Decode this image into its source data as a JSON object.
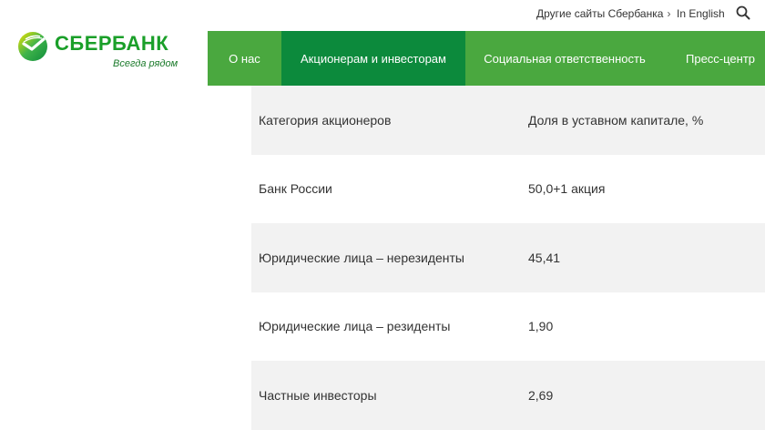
{
  "topbar": {
    "other_sites": "Другие сайты Сбербанка",
    "language": "In English"
  },
  "logo": {
    "brand": "СБЕРБАНК",
    "tagline": "Всегда рядом"
  },
  "nav": {
    "items": [
      {
        "label": "О нас"
      },
      {
        "label": "Акционерам и инвесторам"
      },
      {
        "label": "Социальная ответственность"
      },
      {
        "label": "Пресс-центр"
      }
    ]
  },
  "table": {
    "headers": [
      "Категория акционеров",
      "Доля в уставном капитале, %"
    ],
    "rows": [
      [
        "Банк России",
        "50,0+1 акция"
      ],
      [
        "Юридические лица – нерезиденты",
        "45,41"
      ],
      [
        "Юридические лица – резиденты",
        "1,90"
      ],
      [
        "Частные инвесторы",
        "2,69"
      ]
    ]
  },
  "colors": {
    "brand_green": "#1a9f29",
    "nav_green": "#4aa83f",
    "nav_active": "#0c8a3c",
    "row_shade": "#f2f2f2"
  }
}
